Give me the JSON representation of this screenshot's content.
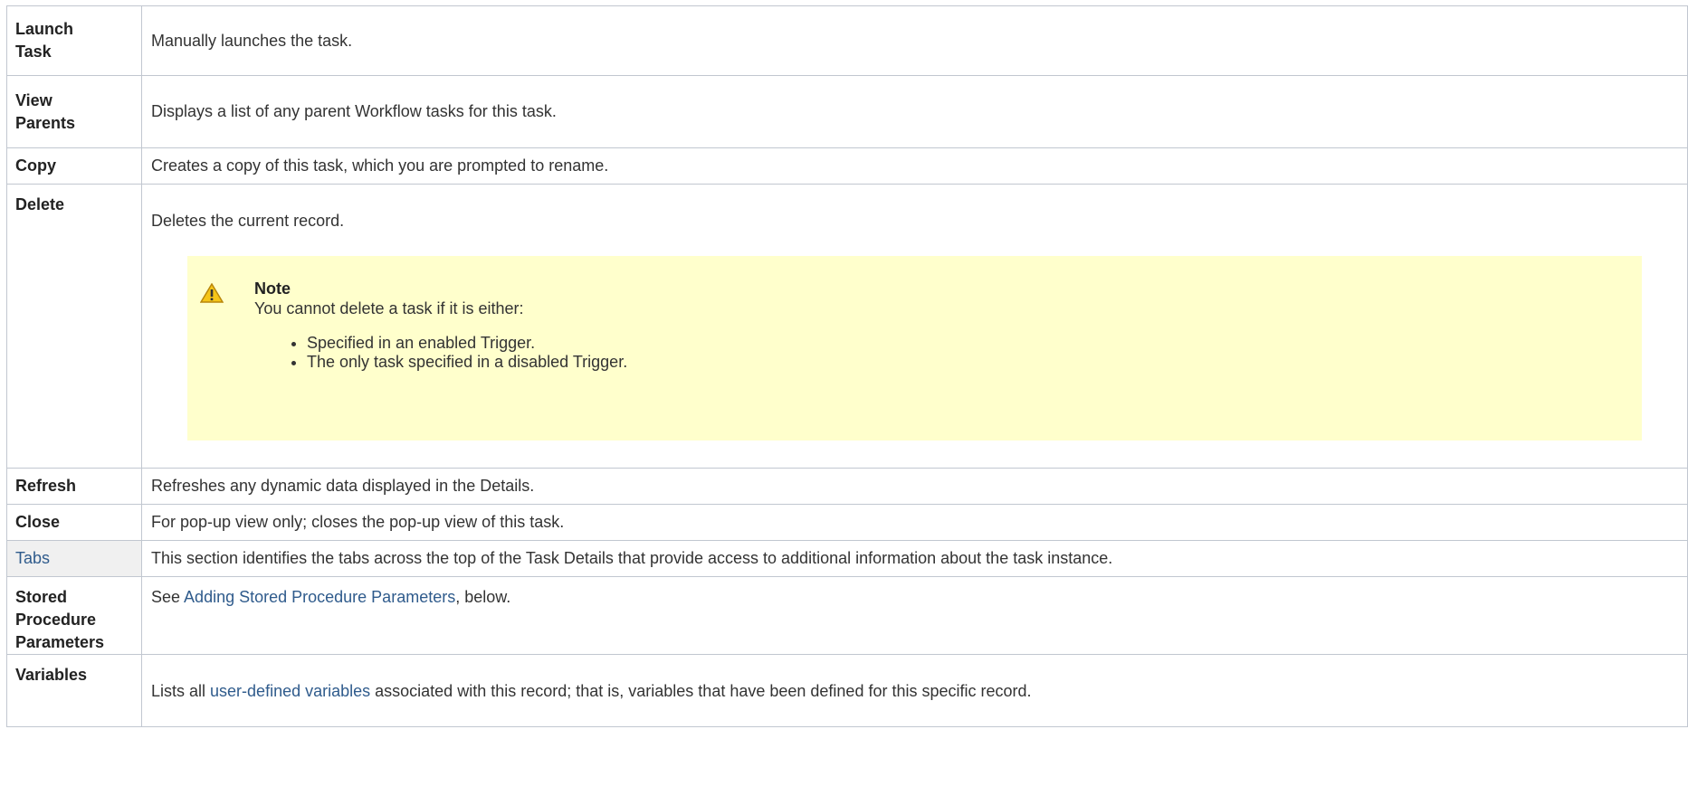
{
  "rows": [
    {
      "label": "Launch Task",
      "description": "Manually launches the task."
    },
    {
      "label": "View Parents",
      "description": "Displays a list of any parent Workflow tasks for this task."
    },
    {
      "label": "Copy",
      "description": "Creates a copy of this task, which you are prompted to rename."
    },
    {
      "label": "Delete",
      "description": "Deletes the current record."
    },
    {
      "label": "Refresh",
      "description": "Refreshes any dynamic data displayed in the Details."
    },
    {
      "label": "Close",
      "description": "For pop-up view only; closes the pop-up view of this task."
    },
    {
      "label": "Tabs",
      "description": "This section identifies the tabs across the top of the Task Details that provide access to additional information about the task instance."
    },
    {
      "label": "Stored Procedure Parameters",
      "description_prefix": "See ",
      "link": "Adding Stored Procedure Parameters",
      "description_suffix": ", below."
    },
    {
      "label": "Variables",
      "description_prefix": "Lists all ",
      "link": "user-defined variables",
      "description_suffix": " associated with this record; that is, variables that have been defined for this specific record."
    }
  ],
  "note": {
    "icon": "warning-icon",
    "title": "Note",
    "text": "You cannot delete a task if it is either:",
    "items": [
      "Specified in an enabled Trigger.",
      "The only task specified in a disabled Trigger."
    ]
  },
  "colors": {
    "link": "#2f5b8c",
    "note_bg": "#ffffcc",
    "border": "#c1c7d0",
    "tabs_bg": "#f0f0f0"
  }
}
